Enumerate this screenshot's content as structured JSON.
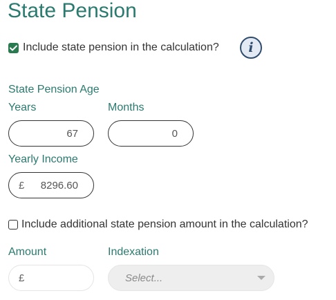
{
  "section": {
    "title": "State Pension"
  },
  "include_state_pension": {
    "label": "Include state pension in the calculation?",
    "checked": true
  },
  "info_button": {
    "glyph": "i",
    "icon": "info-icon"
  },
  "state_pension_age": {
    "heading": "State Pension Age",
    "years_label": "Years",
    "years_value": "67",
    "months_label": "Months",
    "months_value": "0"
  },
  "yearly_income": {
    "label": "Yearly Income",
    "currency": "£",
    "value": "8296.60"
  },
  "include_additional": {
    "label": "Include additional state pension amount in the calculation?",
    "checked": false
  },
  "additional": {
    "amount_label": "Amount",
    "amount_currency": "£",
    "amount_value": "",
    "indexation_label": "Indexation",
    "indexation_placeholder": "Select..."
  },
  "colors": {
    "accent": "#2a7a6f",
    "checkbox": "#2a7a4f",
    "info": "#2f4c6e"
  }
}
